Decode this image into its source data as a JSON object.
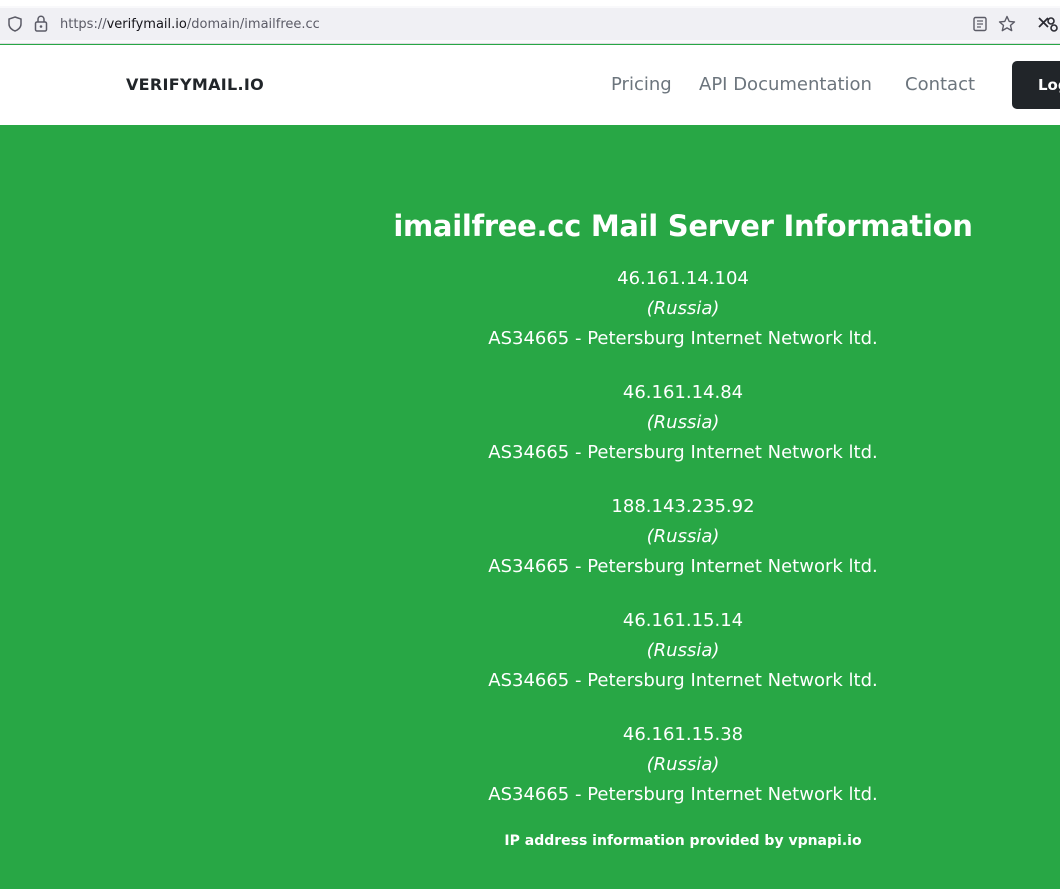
{
  "browser": {
    "url_prefix": "https://",
    "url_host": "verifymail.io",
    "url_path": "/domain/imailfree.cc",
    "icons": [
      "shield-icon",
      "lock-icon",
      "reader-view-icon",
      "bookmark-star-icon",
      "extension-icon"
    ]
  },
  "navbar": {
    "brand": "VERIFYMAIL.IO",
    "links": [
      {
        "label": "Pricing"
      },
      {
        "label": "API Documentation"
      },
      {
        "label": "Contact"
      }
    ],
    "login_label": "Log"
  },
  "main": {
    "title": "imailfree.cc Mail Server Information",
    "servers": [
      {
        "ip": "46.161.14.104",
        "country": "(Russia)",
        "asn": "AS34665 - Petersburg Internet Network ltd."
      },
      {
        "ip": "46.161.14.84",
        "country": "(Russia)",
        "asn": "AS34665 - Petersburg Internet Network ltd."
      },
      {
        "ip": "188.143.235.92",
        "country": "(Russia)",
        "asn": "AS34665 - Petersburg Internet Network ltd."
      },
      {
        "ip": "46.161.15.14",
        "country": "(Russia)",
        "asn": "AS34665 - Petersburg Internet Network ltd."
      },
      {
        "ip": "46.161.15.38",
        "country": "(Russia)",
        "asn": "AS34665 - Petersburg Internet Network ltd."
      }
    ],
    "footer_note": "IP address information provided by vpnapi.io"
  },
  "colors": {
    "background_green": "#28a745",
    "navbar_bg": "#ffffff",
    "login_bg": "#212529"
  }
}
